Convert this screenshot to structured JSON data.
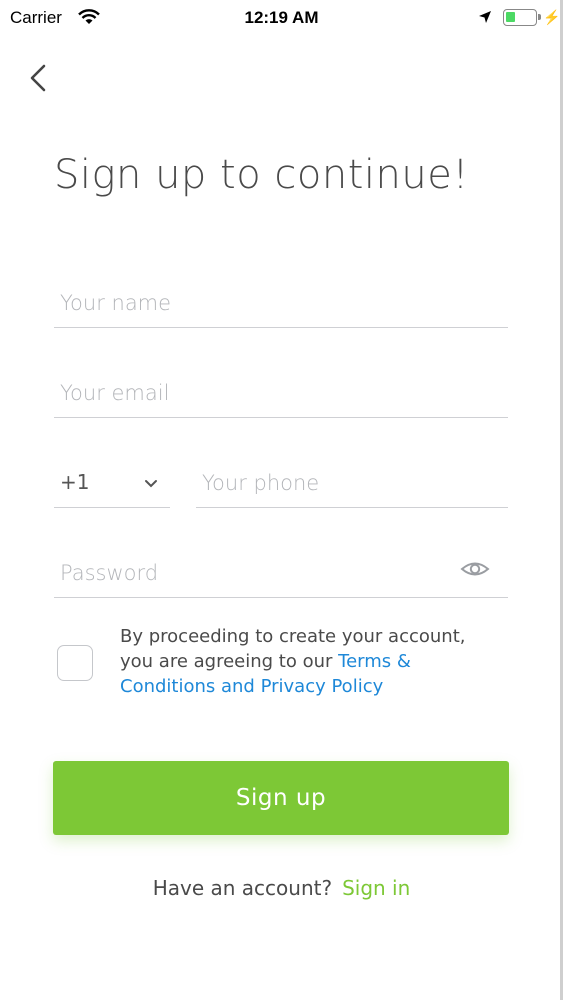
{
  "status_bar": {
    "carrier": "Carrier",
    "time": "12:19 AM",
    "battery_color": "#4cd964"
  },
  "header": {
    "back_icon": "chevron-left-icon",
    "title": "Sign up to continue!"
  },
  "form": {
    "name_placeholder": "Your name",
    "email_placeholder": "Your email",
    "country_code": "+1",
    "phone_placeholder": "Your phone",
    "password_placeholder": "Password",
    "password_toggle_icon": "eye-icon"
  },
  "terms": {
    "checked": false,
    "text": "By proceeding to create your account, you are agreeing to our ",
    "link": "Terms & Conditions and Privacy Policy",
    "link_color": "#1e88d8"
  },
  "actions": {
    "signup_label": "Sign up",
    "accent_color": "#7dc836",
    "have_account_text": "Have an account?",
    "signin_label": "Sign in"
  }
}
